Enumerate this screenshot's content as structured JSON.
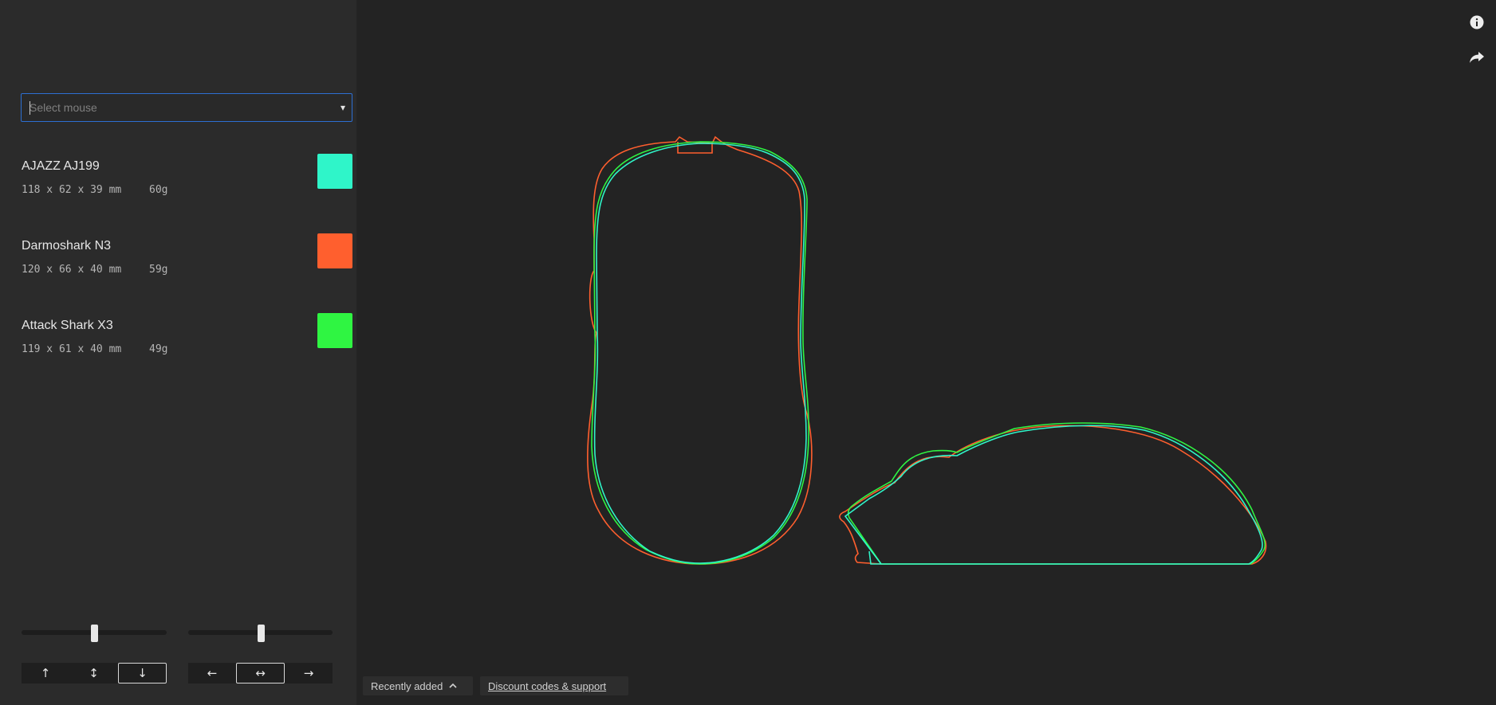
{
  "sidebar": {
    "select": {
      "placeholder": "Select mouse",
      "arrow": "▾"
    },
    "mice": [
      {
        "name": "AJAZZ AJ199",
        "dims": "118 x 62 x 39 mm",
        "weight": "60g",
        "color": "#2ff5c9"
      },
      {
        "name": "Darmoshark N3",
        "dims": "120 x 66 x 40 mm",
        "weight": "59g",
        "color": "#ff5f2e"
      },
      {
        "name": "Attack Shark X3",
        "dims": "119 x 61 x 40 mm",
        "weight": "49g",
        "color": "#2ff542"
      }
    ],
    "sliders": {
      "vertical_offset": {
        "value": 0.5
      },
      "horizontal_offset": {
        "value": 0.5
      }
    },
    "vertical_align": {
      "top_icon": "arrow-up-icon",
      "top_glyph": "↑",
      "center_icon": "arrows-vertical-icon",
      "center_glyph": "↕",
      "bottom_icon": "arrow-down-icon",
      "bottom_glyph": "↓",
      "active": "bottom"
    },
    "horizontal_align": {
      "left_icon": "arrow-left-icon",
      "left_glyph": "←",
      "center_icon": "arrows-horizontal-icon",
      "center_glyph": "↔",
      "right_icon": "arrow-right-icon",
      "right_glyph": "→",
      "active": "center"
    }
  },
  "toolbar": {
    "info_icon": "info-icon",
    "share_icon": "share-icon"
  },
  "footer": {
    "recently_added": "Recently added",
    "discount": "Discount codes & support"
  }
}
